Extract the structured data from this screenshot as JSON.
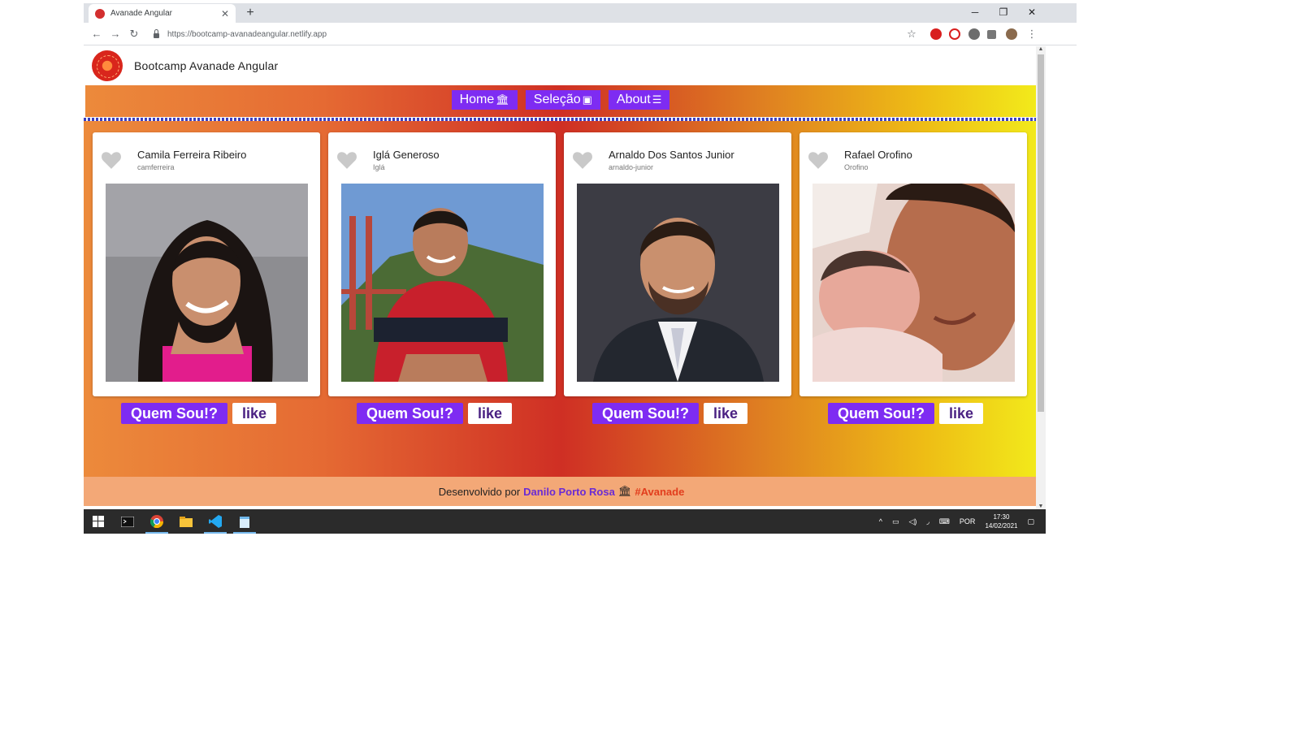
{
  "browser": {
    "tab_title": "Avanade Angular",
    "tab_close": "✕",
    "new_tab": "+",
    "url": "https://bootcamp-avanadeangular.netlify.app",
    "controls": {
      "minimize": "─",
      "restore": "❐",
      "close": "✕"
    },
    "nav": {
      "back": "←",
      "forward": "→",
      "reload": "↻"
    },
    "star": "☆",
    "menu": "⋮"
  },
  "app": {
    "title": "Bootcamp Avanade Angular"
  },
  "nav": {
    "items": [
      {
        "label": "Home",
        "icon": "🏛"
      },
      {
        "label": "Seleção",
        "icon": "▣"
      },
      {
        "label": "About",
        "icon": "☰"
      }
    ]
  },
  "cards": [
    {
      "name": "Camila Ferreira Ribeiro",
      "user": "camferreira",
      "quem_label": "Quem Sou!?",
      "like_label": "like"
    },
    {
      "name": "Iglá Generoso",
      "user": "Iglá",
      "quem_label": "Quem Sou!?",
      "like_label": "like"
    },
    {
      "name": "Arnaldo Dos Santos Junior",
      "user": "arnaldo-junior",
      "quem_label": "Quem Sou!?",
      "like_label": "like"
    },
    {
      "name": "Rafael Orofino",
      "user": "Orofino",
      "quem_label": "Quem Sou!?",
      "like_label": "like"
    }
  ],
  "footer": {
    "prefix": "Desenvolvido por",
    "author": "Danilo Porto Rosa",
    "icon": "🏛",
    "tag": "#Avanade"
  },
  "taskbar": {
    "lang": "POR",
    "time": "17:30",
    "date": "14/02/2021"
  },
  "colors": {
    "accent_purple": "#7e2cf2",
    "footer_bg": "#f3a877",
    "tag_red": "#e23d1d"
  }
}
